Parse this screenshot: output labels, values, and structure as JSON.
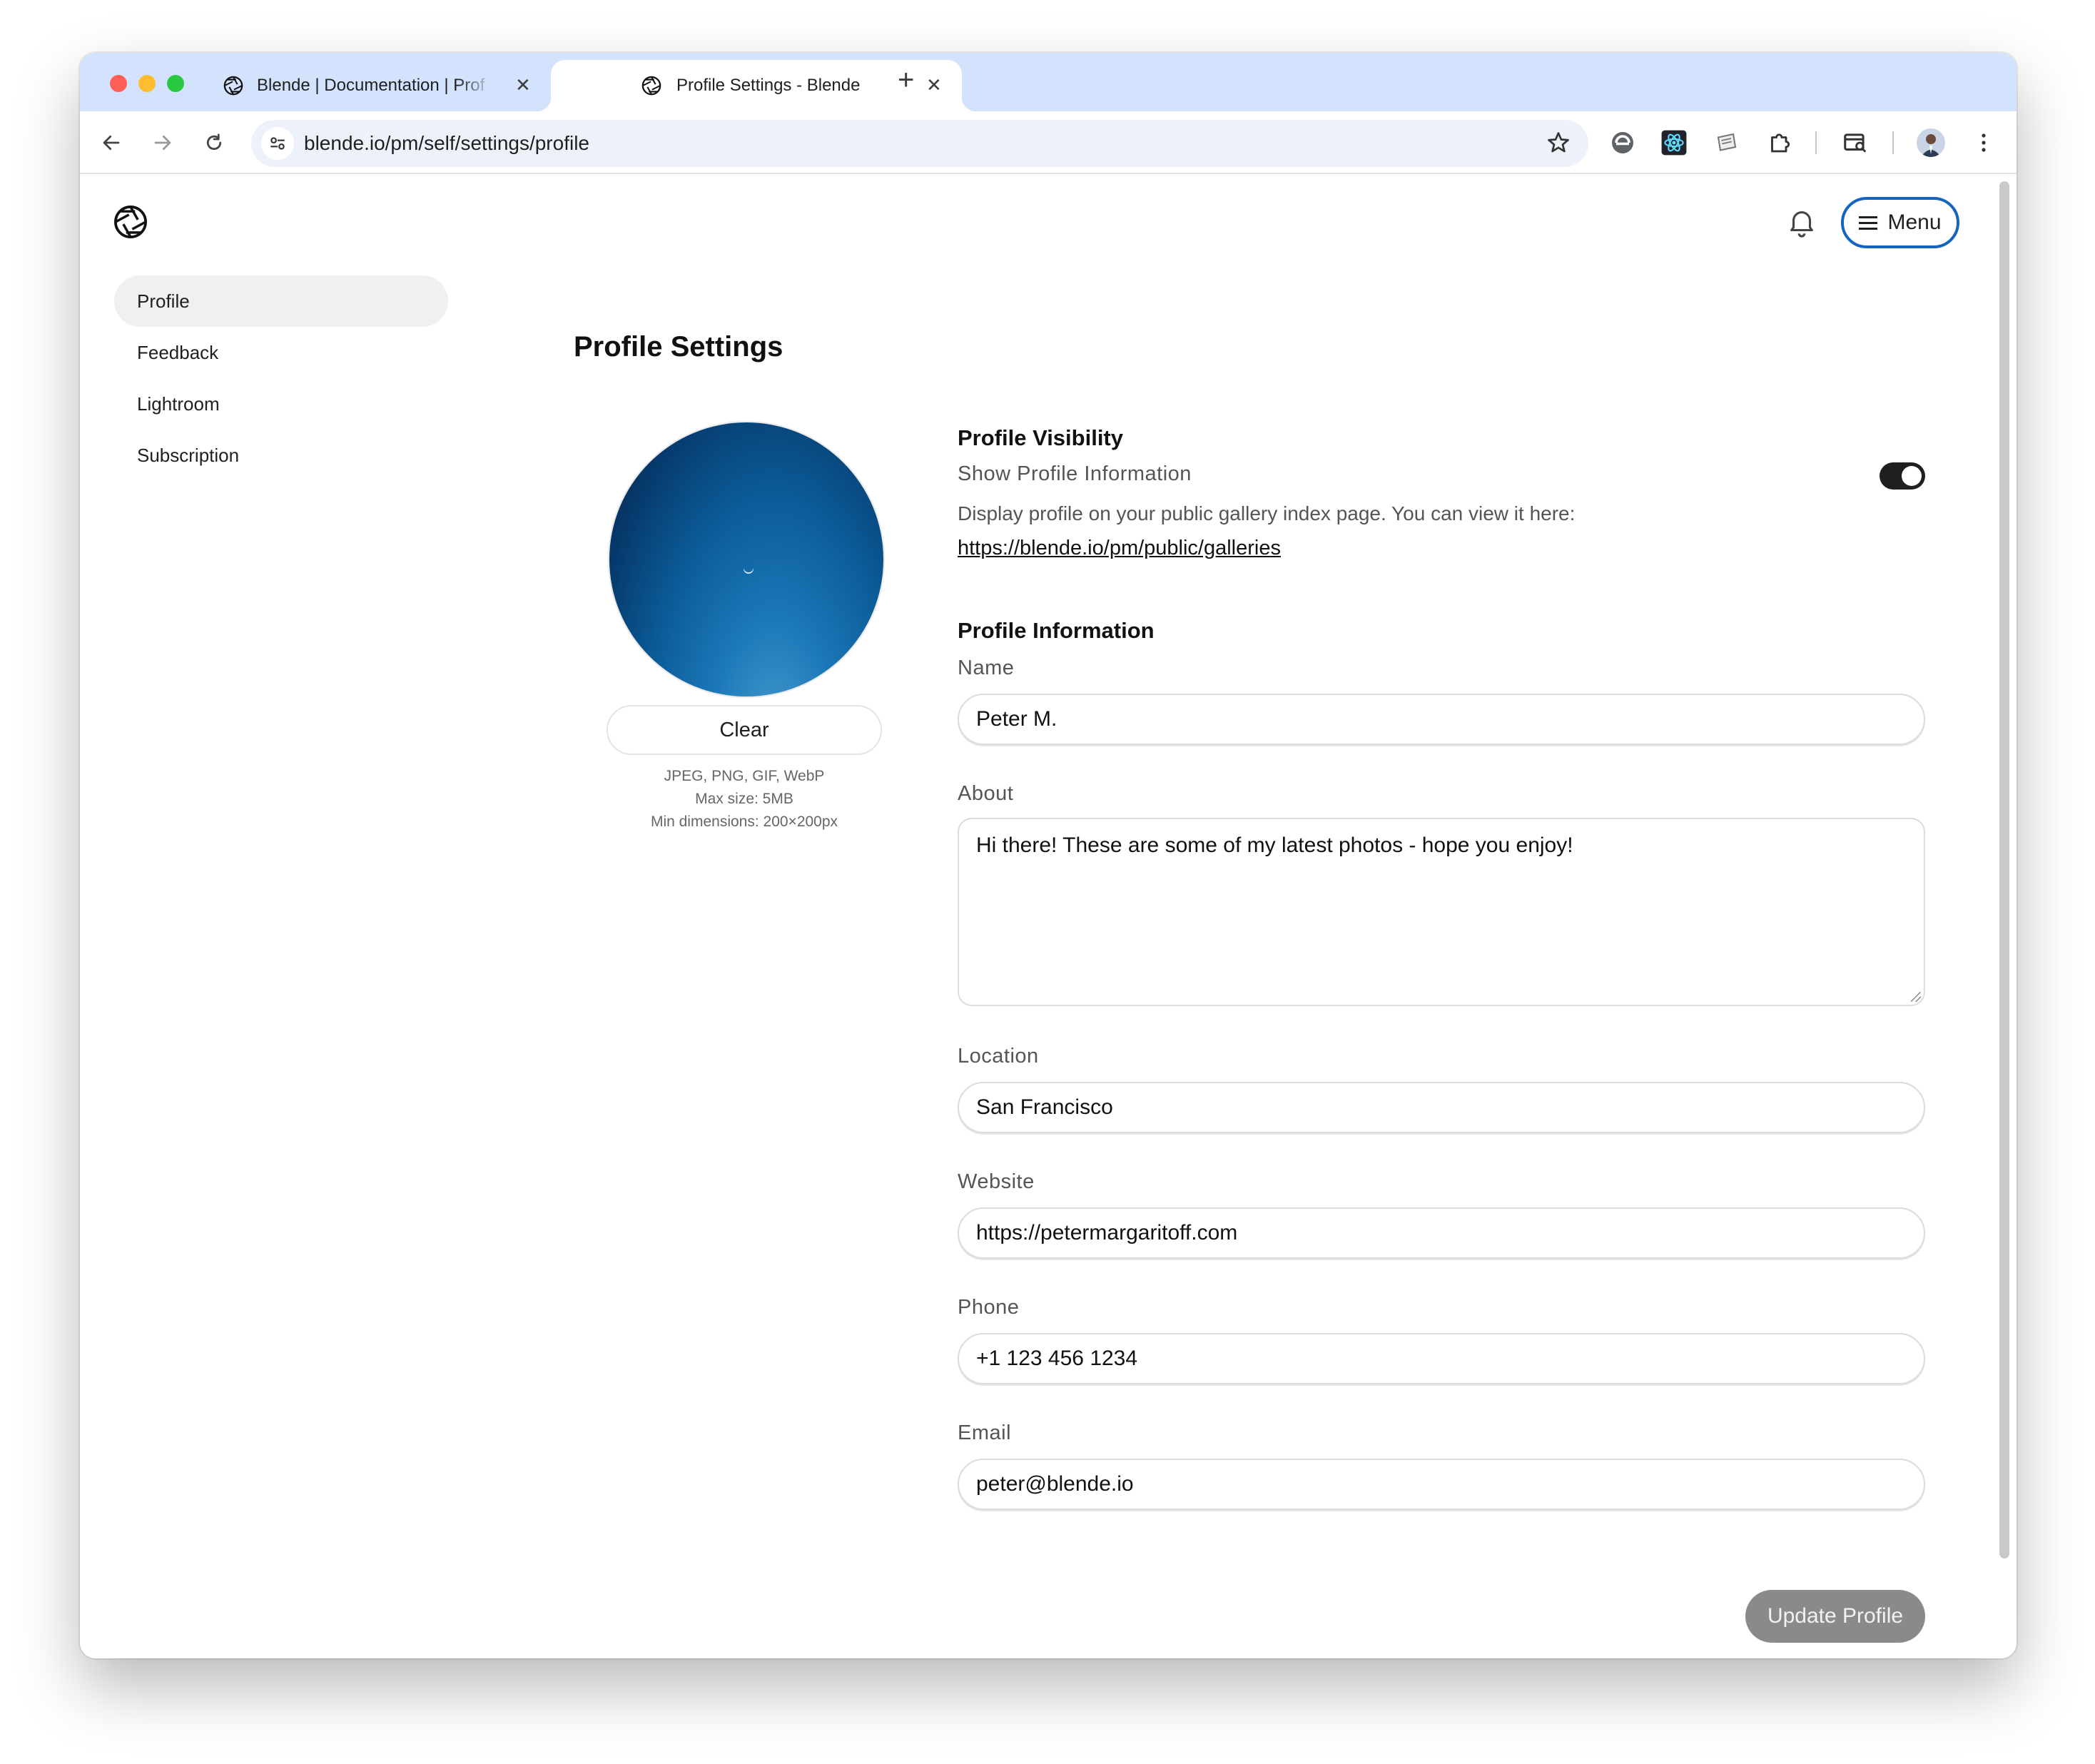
{
  "browser": {
    "tabs": [
      {
        "title": "Blende | Documentation | Prof",
        "active": false
      },
      {
        "title": "Profile Settings - Blende",
        "active": true
      }
    ],
    "url": "blende.io/pm/self/settings/profile"
  },
  "header": {
    "menu_label": "Menu"
  },
  "sidebar": {
    "items": [
      {
        "label": "Profile",
        "active": true
      },
      {
        "label": "Feedback",
        "active": false
      },
      {
        "label": "Lightroom",
        "active": false
      },
      {
        "label": "Subscription",
        "active": false
      }
    ]
  },
  "main": {
    "title": "Profile Settings",
    "avatar": {
      "clear_label": "Clear",
      "hint_formats": "JPEG, PNG, GIF, WebP",
      "hint_size": "Max size: 5MB",
      "hint_dimensions": "Min dimensions: 200×200px"
    },
    "visibility": {
      "title": "Profile Visibility",
      "toggle_label": "Show Profile Information",
      "toggle_on": true,
      "description": "Display profile on your public gallery index page. You can view it here:",
      "link": "https://blende.io/pm/public/galleries"
    },
    "info": {
      "title": "Profile Information",
      "name_label": "Name",
      "name_value": "Peter M.",
      "about_label": "About",
      "about_value": "Hi there! These are some of my latest photos - hope you enjoy!",
      "location_label": "Location",
      "location_value": "San Francisco",
      "website_label": "Website",
      "website_value": "https://petermargaritoff.com",
      "phone_label": "Phone",
      "phone_value": "+1 123 456 1234",
      "email_label": "Email",
      "email_value": "peter@blende.io"
    },
    "update_label": "Update Profile"
  },
  "colors": {
    "tabstrip": "#d3e3fd",
    "accent": "#1565c0",
    "button_disabled": "#8a8a8a"
  }
}
